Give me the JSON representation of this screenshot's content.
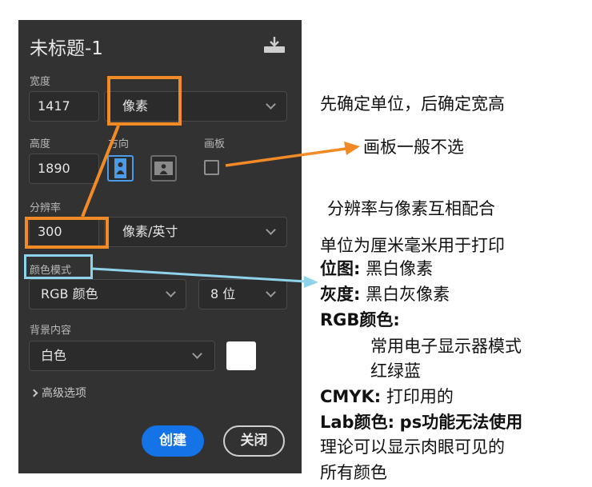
{
  "dialog": {
    "title": "未标题-1",
    "width_label": "宽度",
    "width_value": "1417",
    "width_unit": "像素",
    "height_label": "高度",
    "height_value": "1890",
    "orientation_label": "方向",
    "artboard_label": "画板",
    "resolution_label": "分辨率",
    "resolution_value": "300",
    "resolution_unit": "像素/英寸",
    "color_mode_label": "颜色模式",
    "color_mode_value": "RGB 颜色",
    "bit_depth_value": "8 位",
    "background_label": "背景内容",
    "background_value": "白色",
    "background_swatch_color": "#ffffff",
    "advanced_label": "高级选项",
    "create_label": "创建",
    "close_label": "关闭",
    "accent_color": "#1473e6"
  },
  "annotations": {
    "units_note": "先确定单位，后确定宽高",
    "artboard_note": "画板一般不选",
    "resolution_note": "分辨率与像素互相配合",
    "print_note": "单位为厘米毫米用于打印",
    "bitmap_head": "位图:",
    "bitmap_text": "黑白像素",
    "grayscale_head": "灰度:",
    "grayscale_text": "黑白灰像素",
    "rgb_head": "RGB颜色:",
    "rgb_line1": "常用电子显示器模式",
    "rgb_line2": "红绿蓝",
    "cmyk_head": "CMYK:",
    "cmyk_text": "打印用的",
    "lab_head": "Lab颜色:",
    "lab_text1": "ps功能无法使用",
    "lab_line2": "理论可以显示肉眼可见的",
    "lab_line3": "所有颜色",
    "highlight_color": "#f28a25",
    "highlight_color_blue": "#8fd3ea"
  }
}
